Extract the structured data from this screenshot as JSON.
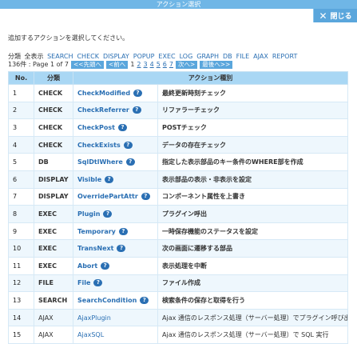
{
  "window": {
    "title": "アクション選択",
    "close_label": "閉じる"
  },
  "instruction": "追加するアクションを選択してください。",
  "filter": {
    "label": "分類",
    "all_label": "全表示",
    "categories": [
      "SEARCH",
      "CHECK",
      "DISPLAY",
      "POPUP",
      "EXEC",
      "LOG",
      "GRAPH",
      "DB",
      "FILE",
      "AJAX",
      "REPORT"
    ]
  },
  "pager": {
    "count_text": "136件 : Page 1 of 7",
    "first_label": "<<先頭へ",
    "prev_label": "<前へ",
    "pages": [
      "1",
      "2",
      "3",
      "4",
      "5",
      "6",
      "7"
    ],
    "current_page": "1",
    "next_label": "次へ>",
    "last_label": "最後へ>>"
  },
  "table": {
    "headers": [
      "No.",
      "分類",
      "アクション種別"
    ],
    "rows": [
      {
        "no": "1",
        "cat": "CHECK",
        "name": "CheckModified",
        "desc": "最終更新時刻チェック",
        "bold": true
      },
      {
        "no": "2",
        "cat": "CHECK",
        "name": "CheckReferrer",
        "desc": "リファラーチェック",
        "bold": true
      },
      {
        "no": "3",
        "cat": "CHECK",
        "name": "CheckPost",
        "desc": "POSTチェック",
        "bold": true
      },
      {
        "no": "4",
        "cat": "CHECK",
        "name": "CheckExists",
        "desc": "データの存在チェック",
        "bold": true
      },
      {
        "no": "5",
        "cat": "DB",
        "name": "SqlDtlWhere",
        "desc": "指定した表示部品のキー条件のWHERE部を作成",
        "bold": true
      },
      {
        "no": "6",
        "cat": "DISPLAY",
        "name": "Visible",
        "desc": "表示部品の表示・非表示を設定",
        "bold": true
      },
      {
        "no": "7",
        "cat": "DISPLAY",
        "name": "OverridePartAttr",
        "desc": "コンポーネント属性を上書き",
        "bold": true
      },
      {
        "no": "8",
        "cat": "EXEC",
        "name": "Plugin",
        "desc": "プラグイン呼出",
        "bold": true
      },
      {
        "no": "9",
        "cat": "EXEC",
        "name": "Temporary",
        "desc": "一時保存機能のステータスを設定",
        "bold": true
      },
      {
        "no": "10",
        "cat": "EXEC",
        "name": "TransNext",
        "desc": "次の画面に遷移する部品",
        "bold": true
      },
      {
        "no": "11",
        "cat": "EXEC",
        "name": "Abort",
        "desc": "表示処理を中断",
        "bold": true
      },
      {
        "no": "12",
        "cat": "FILE",
        "name": "File",
        "desc": "ファイル作成",
        "bold": true
      },
      {
        "no": "13",
        "cat": "SEARCH",
        "name": "SearchCondition",
        "desc": "検索条件の保存と取得を行う",
        "bold": true
      },
      {
        "no": "14",
        "cat": "AJAX",
        "name": "AjaxPlugin",
        "desc": "Ajax 通信のレスポンス処理（サーバー処理）でプラグイン呼び出し",
        "bold": false
      },
      {
        "no": "15",
        "cat": "AJAX",
        "name": "AjaxSQL",
        "desc": "Ajax 通信のレスポンス処理（サーバー処理）で SQL 実行",
        "bold": false
      }
    ]
  },
  "icons": {
    "help": "help-bubble-icon",
    "close": "close-x-icon"
  },
  "colors": {
    "title_bar": "#6fb6e6",
    "header": "#a9d7f4",
    "link": "#2a6fb3",
    "button": "#5aa6dc"
  }
}
